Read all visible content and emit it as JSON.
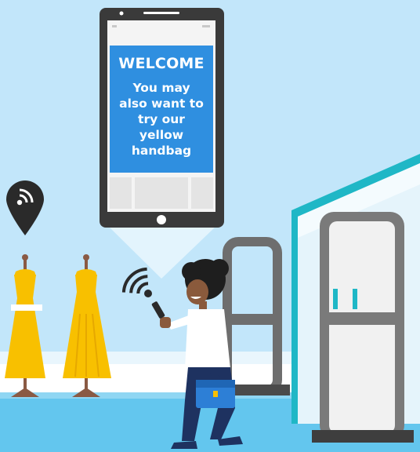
{
  "phone_screen": {
    "title": "WELCOME",
    "message": "You may also want to try our yellow handbag"
  },
  "colors": {
    "sky": "#c2e6fa",
    "floor": "#63c6ee",
    "screen_card": "#2f8fe0",
    "phone_body": "#3a3a3a",
    "dress": "#f8c000",
    "gate": "#7a7a7a",
    "gate_teal": "#1fb7c6",
    "pin": "#2a2a2a",
    "shopper_shirt": "#ffffff",
    "shopper_pants": "#1e3260",
    "handbag": "#2d7fd6"
  },
  "icons": [
    "location-pin-icon",
    "wifi-signal-icon",
    "beacon-signal-icon"
  ]
}
